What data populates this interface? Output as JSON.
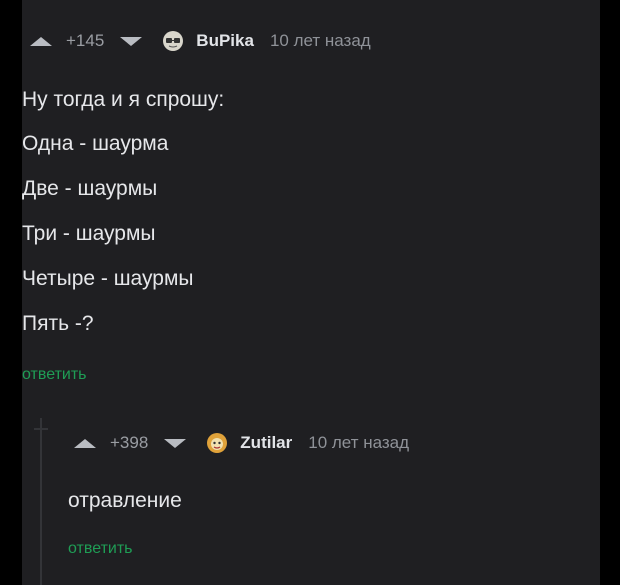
{
  "comment1": {
    "rating": "+145",
    "user": "BuPika",
    "time": "10 лет назад",
    "lines": [
      "Ну тогда и я спрошу:",
      "Одна - шаурма",
      "Две - шаурмы",
      "Три - шаурмы",
      "Четыре - шаурмы",
      "Пять -?"
    ],
    "reply_label": "ответить"
  },
  "comment2": {
    "rating": "+398",
    "user": "Zutilar",
    "time": "10 лет назад",
    "text": "отравление",
    "reply_label": "ответить"
  },
  "colors": {
    "background": "#1f1f22",
    "reply_link": "#1f9d55",
    "text": "#e6e7ea"
  }
}
